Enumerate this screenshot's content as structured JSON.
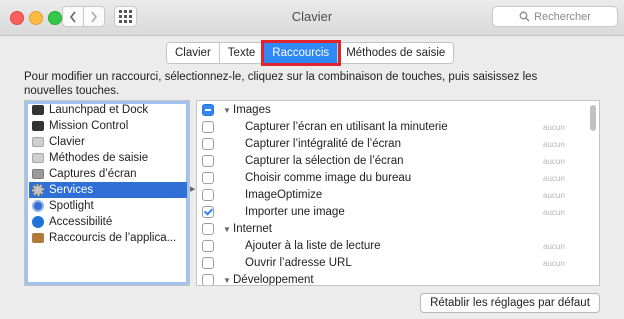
{
  "window": {
    "title": "Clavier"
  },
  "search": {
    "placeholder": "Rechercher",
    "icon": "search-icon"
  },
  "tabs": [
    {
      "label": "Clavier",
      "active": false
    },
    {
      "label": "Texte",
      "active": false
    },
    {
      "label": "Raccourcis",
      "active": true
    },
    {
      "label": "Méthodes de saisie",
      "active": false
    }
  ],
  "description": "Pour modifier un raccourci, sélectionnez-le, cliquez sur la combinaison de touches, puis saisissez les nouvelles touches.",
  "categories": [
    {
      "label": "Launchpad et Dock",
      "icon": "launchpad-icon",
      "selected": false
    },
    {
      "label": "Mission Control",
      "icon": "mission-control-icon",
      "selected": false
    },
    {
      "label": "Clavier",
      "icon": "keyboard-icon",
      "selected": false
    },
    {
      "label": "Méthodes de saisie",
      "icon": "input-methods-icon",
      "selected": false
    },
    {
      "label": "Captures d’écran",
      "icon": "screenshot-icon",
      "selected": false
    },
    {
      "label": "Services",
      "icon": "gear-icon",
      "selected": true
    },
    {
      "label": "Spotlight",
      "icon": "spotlight-icon",
      "selected": false
    },
    {
      "label": "Accessibilité",
      "icon": "accessibility-icon",
      "selected": false
    },
    {
      "label": "Raccourcis de l’applica...",
      "icon": "app-shortcuts-icon",
      "selected": false
    }
  ],
  "shortcuts": [
    {
      "type": "group",
      "label": "Images",
      "state": "mixed"
    },
    {
      "type": "item",
      "label": "Capturer l’écran en utilisant la minuterie",
      "state": "unchecked",
      "shortcut": "aucun"
    },
    {
      "type": "item",
      "label": "Capturer l’intégralité de l’écran",
      "state": "unchecked",
      "shortcut": "aucun"
    },
    {
      "type": "item",
      "label": "Capturer la sélection de l’écran",
      "state": "unchecked",
      "shortcut": "aucun"
    },
    {
      "type": "item",
      "label": "Choisir comme image du bureau",
      "state": "unchecked",
      "shortcut": "aucun"
    },
    {
      "type": "item",
      "label": "ImageOptimize",
      "state": "unchecked",
      "shortcut": "aucun"
    },
    {
      "type": "item",
      "label": "Importer une image",
      "state": "checked",
      "shortcut": "aucun"
    },
    {
      "type": "group",
      "label": "Internet",
      "state": "unchecked"
    },
    {
      "type": "item",
      "label": "Ajouter à la liste de lecture",
      "state": "unchecked",
      "shortcut": "aucun"
    },
    {
      "type": "item",
      "label": "Ouvrir l’adresse URL",
      "state": "unchecked",
      "shortcut": "aucun"
    },
    {
      "type": "group",
      "label": "Développement",
      "state": "unchecked"
    }
  ],
  "footer": {
    "reset_label": "Rétablir les réglages par défaut"
  },
  "colors": {
    "accent": "#2f88f5",
    "selection": "#2f6fd6",
    "highlight_box": "#e0262c"
  }
}
